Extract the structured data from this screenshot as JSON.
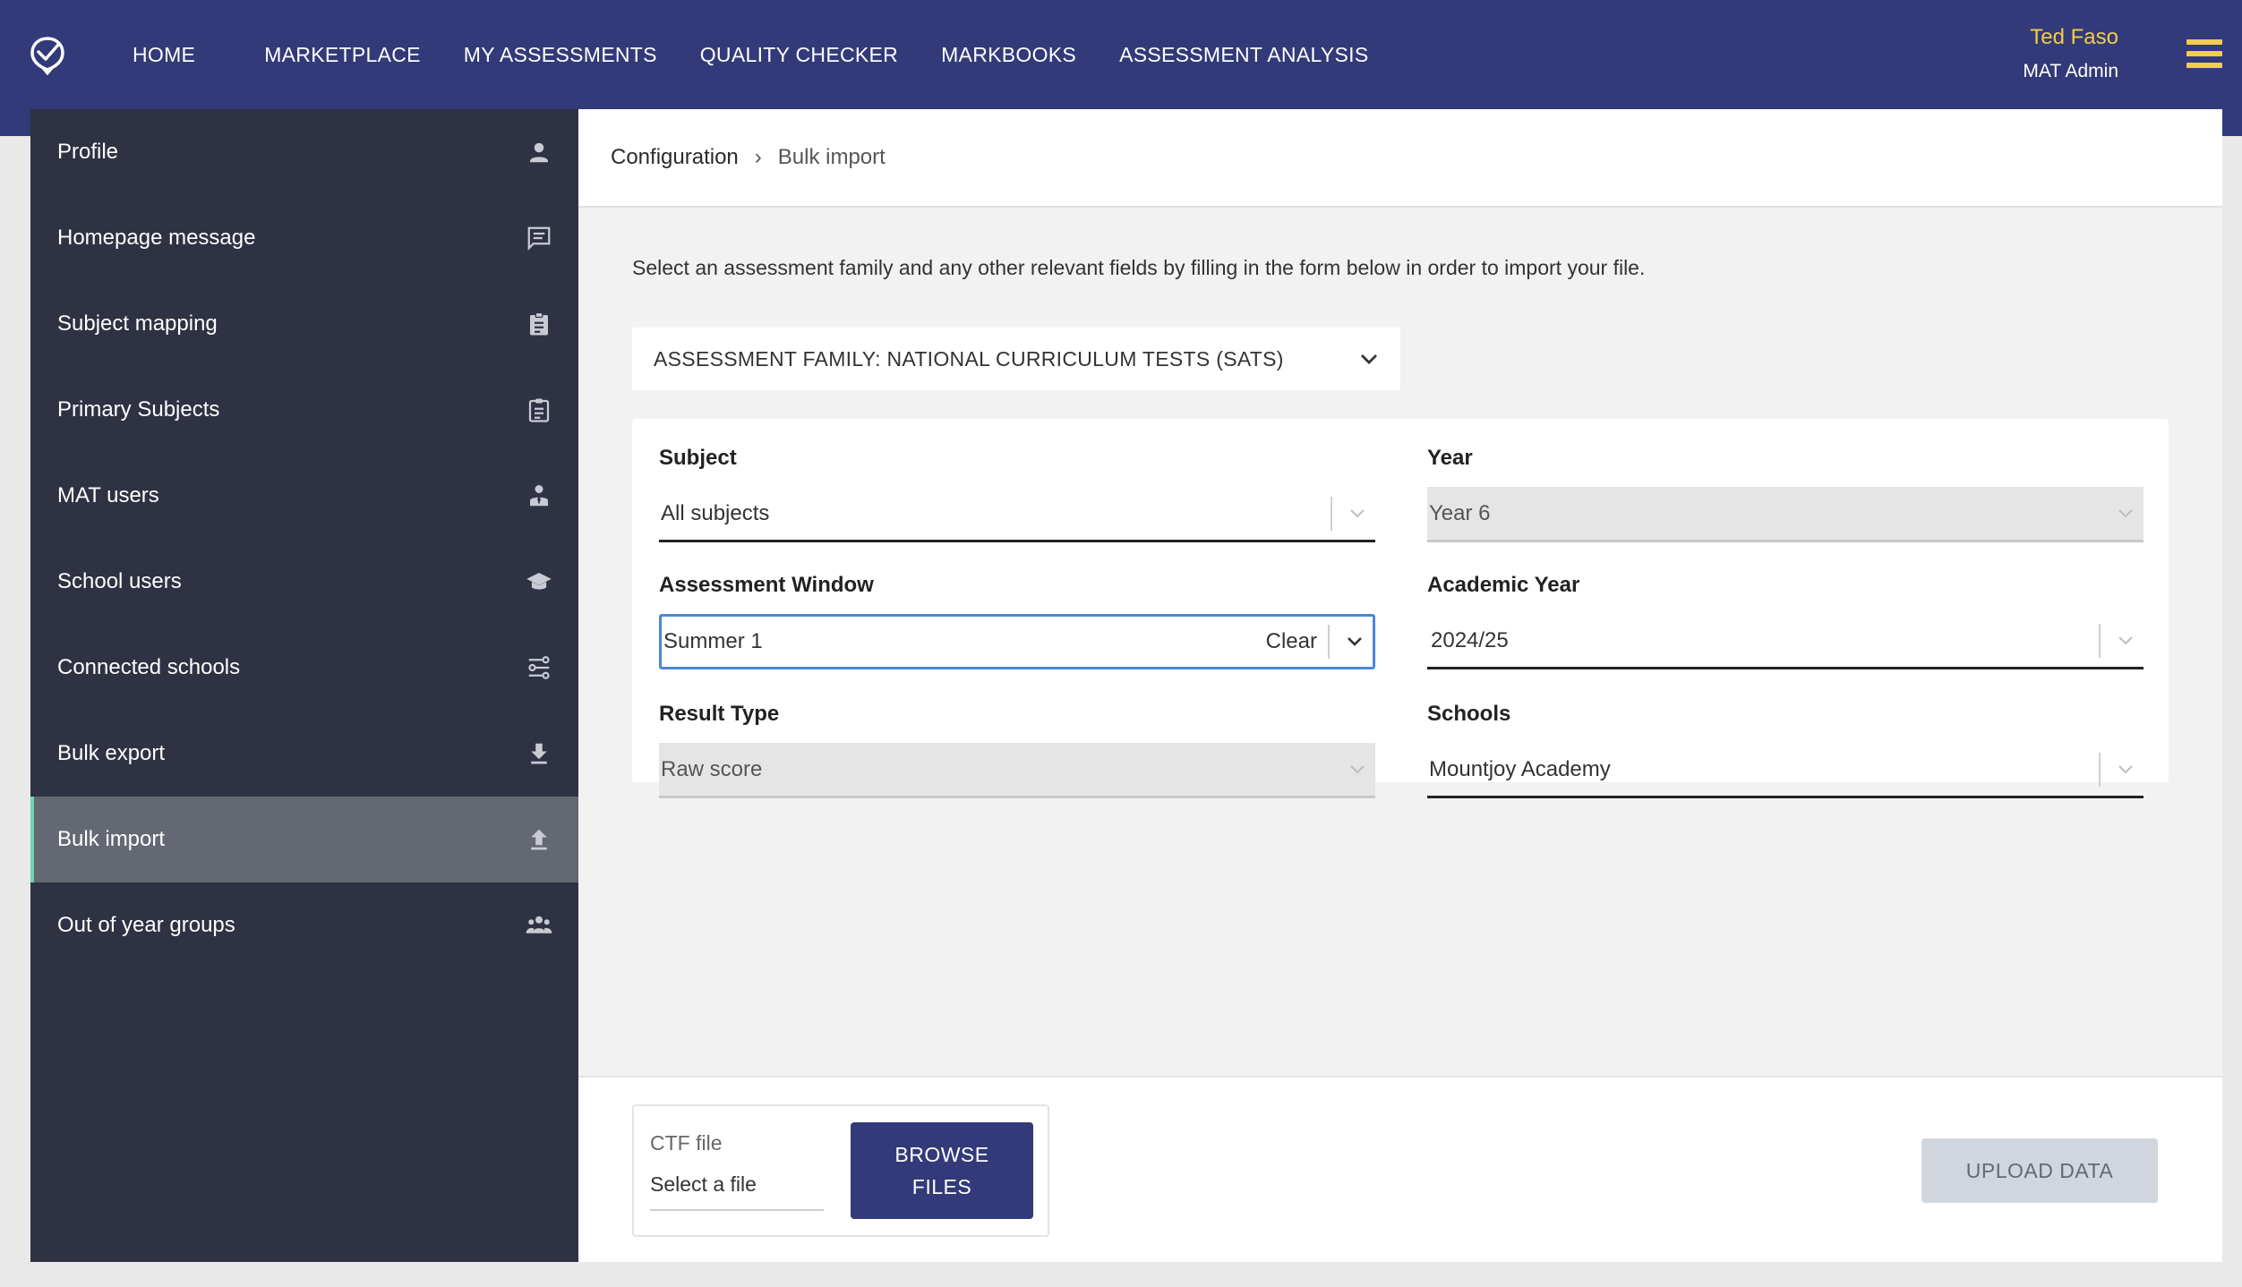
{
  "topnav": {
    "items": [
      "HOME",
      "MARKETPLACE",
      "MY ASSESSMENTS",
      "QUALITY CHECKER",
      "MARKBOOKS",
      "ASSESSMENT ANALYSIS"
    ],
    "user_name": "Ted Faso",
    "user_role": "MAT Admin"
  },
  "sidebar": {
    "items": [
      {
        "label": "Profile",
        "icon": "person-icon"
      },
      {
        "label": "Homepage message",
        "icon": "message-icon"
      },
      {
        "label": "Subject mapping",
        "icon": "clipboard-filled-icon"
      },
      {
        "label": "Primary Subjects",
        "icon": "clipboard-outline-icon"
      },
      {
        "label": "MAT users",
        "icon": "admin-user-icon"
      },
      {
        "label": "School users",
        "icon": "graduation-cap-icon"
      },
      {
        "label": "Connected schools",
        "icon": "connection-icon"
      },
      {
        "label": "Bulk export",
        "icon": "download-icon"
      },
      {
        "label": "Bulk import",
        "icon": "upload-icon",
        "active": true
      },
      {
        "label": "Out of year groups",
        "icon": "group-icon"
      }
    ]
  },
  "breadcrumb": {
    "parent": "Configuration",
    "separator": "›",
    "current": "Bulk import"
  },
  "intro_text": "Select an assessment family and any other relevant fields by filling in the form below in order to import your file.",
  "assessment_family": "ASSESSMENT FAMILY: NATIONAL CURRICULUM TESTS (SATS)",
  "form": {
    "subject": {
      "label": "Subject",
      "value": "All subjects"
    },
    "year": {
      "label": "Year",
      "value": "Year 6"
    },
    "assessment_window": {
      "label": "Assessment Window",
      "value": "Summer 1",
      "clear": "Clear"
    },
    "academic_year": {
      "label": "Academic Year",
      "value": "2024/25"
    },
    "result_type": {
      "label": "Result Type",
      "value": "Raw score"
    },
    "schools": {
      "label": "Schools",
      "value": "Mountjoy Academy"
    }
  },
  "upload": {
    "file_label": "CTF file",
    "file_placeholder": "Select a file",
    "browse_label": "BROWSE FILES",
    "upload_label": "UPLOAD DATA"
  },
  "colors": {
    "topbar": "#323a79",
    "sidebar": "#2e3242",
    "accent_yellow": "#f2cd4a",
    "active_border": "#6fd3b0",
    "focus_blue": "#4b88d9"
  }
}
